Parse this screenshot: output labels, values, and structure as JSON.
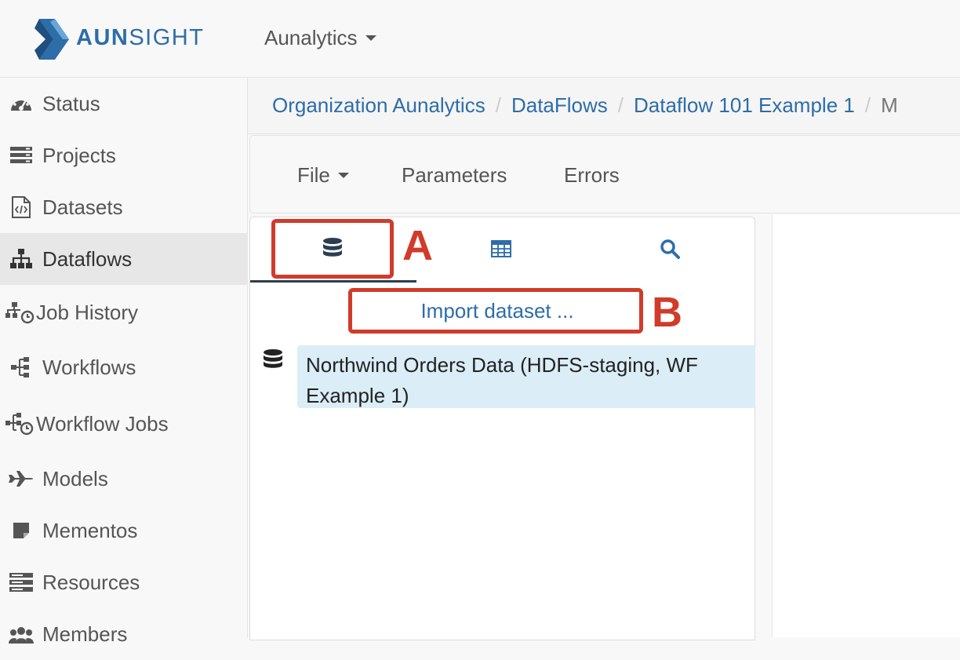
{
  "navbar": {
    "brand_prefix": "AUN",
    "brand_suffix": "SIGHT",
    "org_dropdown": "Aunalytics"
  },
  "sidebar": {
    "items": [
      {
        "label": "Status",
        "icon": "dashboard-icon"
      },
      {
        "label": "Projects",
        "icon": "projects-icon"
      },
      {
        "label": "Datasets",
        "icon": "file-code-icon"
      },
      {
        "label": "Dataflows",
        "icon": "sitemap-icon",
        "active": true
      },
      {
        "label": "Job History",
        "icon": "job-history-icon"
      },
      {
        "label": "Workflows",
        "icon": "workflow-icon"
      },
      {
        "label": "Workflow Jobs",
        "icon": "workflow-jobs-icon"
      },
      {
        "label": "Models",
        "icon": "plane-icon"
      },
      {
        "label": "Mementos",
        "icon": "sticky-note-icon"
      },
      {
        "label": "Resources",
        "icon": "server-icon"
      },
      {
        "label": "Members",
        "icon": "users-icon"
      }
    ]
  },
  "breadcrumb": {
    "items": [
      "Organization Aunalytics",
      "DataFlows",
      "Dataflow 101 Example 1",
      "M"
    ]
  },
  "toolbar": {
    "file_label": "File",
    "parameters_label": "Parameters",
    "errors_label": "Errors"
  },
  "panel": {
    "tabs": [
      {
        "icon": "database-icon",
        "active": true
      },
      {
        "icon": "table-icon"
      },
      {
        "icon": "search-icon"
      }
    ],
    "import_label": "Import dataset ...",
    "datasets": [
      {
        "line1": "Northwind Orders Data (HDFS-staging, WF",
        "line2": "Example 1)"
      }
    ]
  },
  "annotations": {
    "a": "A",
    "b": "B",
    "color": "#d13b2a"
  },
  "colors": {
    "link": "#2d6da8",
    "selected_row": "#dbedf7",
    "active_tab_underline": "#2c3e50"
  }
}
